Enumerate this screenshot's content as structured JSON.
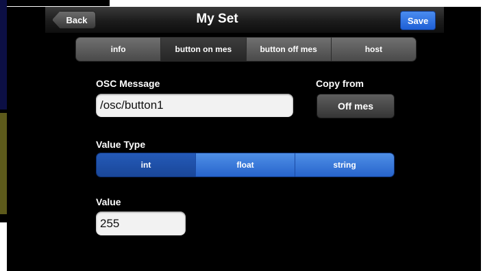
{
  "navbar": {
    "back_label": "Back",
    "title": "My Set",
    "save_label": "Save"
  },
  "tabs": [
    {
      "label": "info",
      "selected": false
    },
    {
      "label": "button on mes",
      "selected": true
    },
    {
      "label": "button off mes",
      "selected": false
    },
    {
      "label": "host",
      "selected": false
    }
  ],
  "osc": {
    "label": "OSC Message",
    "value": "/osc/button1"
  },
  "copy_from": {
    "label": "Copy from",
    "button_label": "Off mes"
  },
  "value_type": {
    "label": "Value Type",
    "options": [
      {
        "label": "int",
        "selected": true
      },
      {
        "label": "float",
        "selected": false
      },
      {
        "label": "string",
        "selected": false
      }
    ]
  },
  "value": {
    "label": "Value",
    "value": "255"
  },
  "colors": {
    "save_blue": "#1e5fd6",
    "segment_blue": "#2764cc"
  }
}
